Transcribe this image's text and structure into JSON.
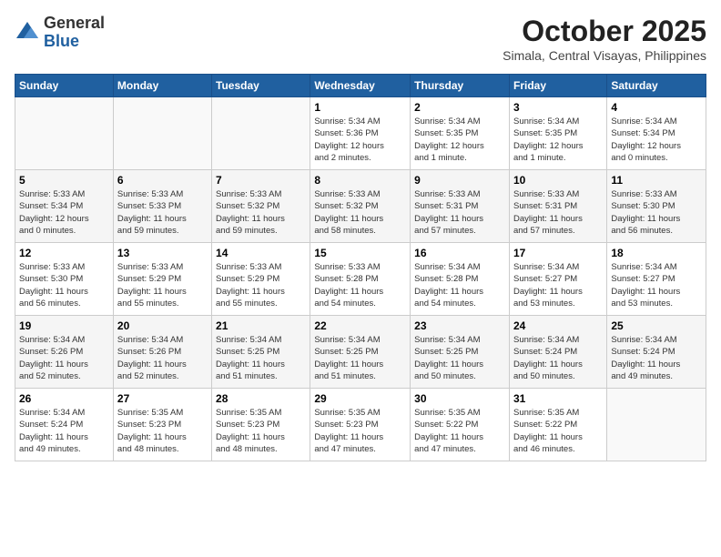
{
  "header": {
    "logo_general": "General",
    "logo_blue": "Blue",
    "month_title": "October 2025",
    "subtitle": "Simala, Central Visayas, Philippines"
  },
  "weekdays": [
    "Sunday",
    "Monday",
    "Tuesday",
    "Wednesday",
    "Thursday",
    "Friday",
    "Saturday"
  ],
  "weeks": [
    [
      {
        "day": "",
        "info": ""
      },
      {
        "day": "",
        "info": ""
      },
      {
        "day": "",
        "info": ""
      },
      {
        "day": "1",
        "info": "Sunrise: 5:34 AM\nSunset: 5:36 PM\nDaylight: 12 hours\nand 2 minutes."
      },
      {
        "day": "2",
        "info": "Sunrise: 5:34 AM\nSunset: 5:35 PM\nDaylight: 12 hours\nand 1 minute."
      },
      {
        "day": "3",
        "info": "Sunrise: 5:34 AM\nSunset: 5:35 PM\nDaylight: 12 hours\nand 1 minute."
      },
      {
        "day": "4",
        "info": "Sunrise: 5:34 AM\nSunset: 5:34 PM\nDaylight: 12 hours\nand 0 minutes."
      }
    ],
    [
      {
        "day": "5",
        "info": "Sunrise: 5:33 AM\nSunset: 5:34 PM\nDaylight: 12 hours\nand 0 minutes."
      },
      {
        "day": "6",
        "info": "Sunrise: 5:33 AM\nSunset: 5:33 PM\nDaylight: 11 hours\nand 59 minutes."
      },
      {
        "day": "7",
        "info": "Sunrise: 5:33 AM\nSunset: 5:32 PM\nDaylight: 11 hours\nand 59 minutes."
      },
      {
        "day": "8",
        "info": "Sunrise: 5:33 AM\nSunset: 5:32 PM\nDaylight: 11 hours\nand 58 minutes."
      },
      {
        "day": "9",
        "info": "Sunrise: 5:33 AM\nSunset: 5:31 PM\nDaylight: 11 hours\nand 57 minutes."
      },
      {
        "day": "10",
        "info": "Sunrise: 5:33 AM\nSunset: 5:31 PM\nDaylight: 11 hours\nand 57 minutes."
      },
      {
        "day": "11",
        "info": "Sunrise: 5:33 AM\nSunset: 5:30 PM\nDaylight: 11 hours\nand 56 minutes."
      }
    ],
    [
      {
        "day": "12",
        "info": "Sunrise: 5:33 AM\nSunset: 5:30 PM\nDaylight: 11 hours\nand 56 minutes."
      },
      {
        "day": "13",
        "info": "Sunrise: 5:33 AM\nSunset: 5:29 PM\nDaylight: 11 hours\nand 55 minutes."
      },
      {
        "day": "14",
        "info": "Sunrise: 5:33 AM\nSunset: 5:29 PM\nDaylight: 11 hours\nand 55 minutes."
      },
      {
        "day": "15",
        "info": "Sunrise: 5:33 AM\nSunset: 5:28 PM\nDaylight: 11 hours\nand 54 minutes."
      },
      {
        "day": "16",
        "info": "Sunrise: 5:34 AM\nSunset: 5:28 PM\nDaylight: 11 hours\nand 54 minutes."
      },
      {
        "day": "17",
        "info": "Sunrise: 5:34 AM\nSunset: 5:27 PM\nDaylight: 11 hours\nand 53 minutes."
      },
      {
        "day": "18",
        "info": "Sunrise: 5:34 AM\nSunset: 5:27 PM\nDaylight: 11 hours\nand 53 minutes."
      }
    ],
    [
      {
        "day": "19",
        "info": "Sunrise: 5:34 AM\nSunset: 5:26 PM\nDaylight: 11 hours\nand 52 minutes."
      },
      {
        "day": "20",
        "info": "Sunrise: 5:34 AM\nSunset: 5:26 PM\nDaylight: 11 hours\nand 52 minutes."
      },
      {
        "day": "21",
        "info": "Sunrise: 5:34 AM\nSunset: 5:25 PM\nDaylight: 11 hours\nand 51 minutes."
      },
      {
        "day": "22",
        "info": "Sunrise: 5:34 AM\nSunset: 5:25 PM\nDaylight: 11 hours\nand 51 minutes."
      },
      {
        "day": "23",
        "info": "Sunrise: 5:34 AM\nSunset: 5:25 PM\nDaylight: 11 hours\nand 50 minutes."
      },
      {
        "day": "24",
        "info": "Sunrise: 5:34 AM\nSunset: 5:24 PM\nDaylight: 11 hours\nand 50 minutes."
      },
      {
        "day": "25",
        "info": "Sunrise: 5:34 AM\nSunset: 5:24 PM\nDaylight: 11 hours\nand 49 minutes."
      }
    ],
    [
      {
        "day": "26",
        "info": "Sunrise: 5:34 AM\nSunset: 5:24 PM\nDaylight: 11 hours\nand 49 minutes."
      },
      {
        "day": "27",
        "info": "Sunrise: 5:35 AM\nSunset: 5:23 PM\nDaylight: 11 hours\nand 48 minutes."
      },
      {
        "day": "28",
        "info": "Sunrise: 5:35 AM\nSunset: 5:23 PM\nDaylight: 11 hours\nand 48 minutes."
      },
      {
        "day": "29",
        "info": "Sunrise: 5:35 AM\nSunset: 5:23 PM\nDaylight: 11 hours\nand 47 minutes."
      },
      {
        "day": "30",
        "info": "Sunrise: 5:35 AM\nSunset: 5:22 PM\nDaylight: 11 hours\nand 47 minutes."
      },
      {
        "day": "31",
        "info": "Sunrise: 5:35 AM\nSunset: 5:22 PM\nDaylight: 11 hours\nand 46 minutes."
      },
      {
        "day": "",
        "info": ""
      }
    ]
  ]
}
